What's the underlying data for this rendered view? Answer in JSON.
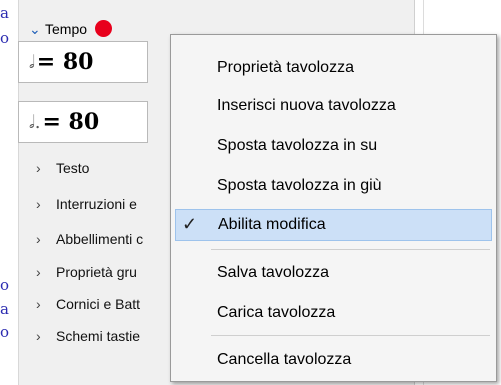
{
  "left_edge_chars": [
    "a",
    "o",
    "o",
    "a",
    "o"
  ],
  "palette": {
    "section_title": "Tempo",
    "tempo_rows": [
      {
        "note": "𝅗𝅥",
        "value": "= 80"
      },
      {
        "note": "𝅗𝅥.",
        "value": "= 80"
      }
    ],
    "categories": [
      "Testo",
      "Interruzioni e",
      "Abbellimenti c",
      "Proprietà gru",
      "Cornici e Batt",
      "Schemi tastie"
    ]
  },
  "context_menu": {
    "items": [
      "Proprietà tavolozza",
      "Inserisci nuova tavolozza",
      "Sposta tavolozza in su",
      "Sposta tavolozza in giù",
      "Abilita modifica",
      "Salva tavolozza",
      "Carica tavolozza",
      "Cancella tavolozza"
    ],
    "checked_item": "Abilita modifica"
  },
  "colors": {
    "accent_red": "#e8001c",
    "highlight": "#cce0f7"
  }
}
